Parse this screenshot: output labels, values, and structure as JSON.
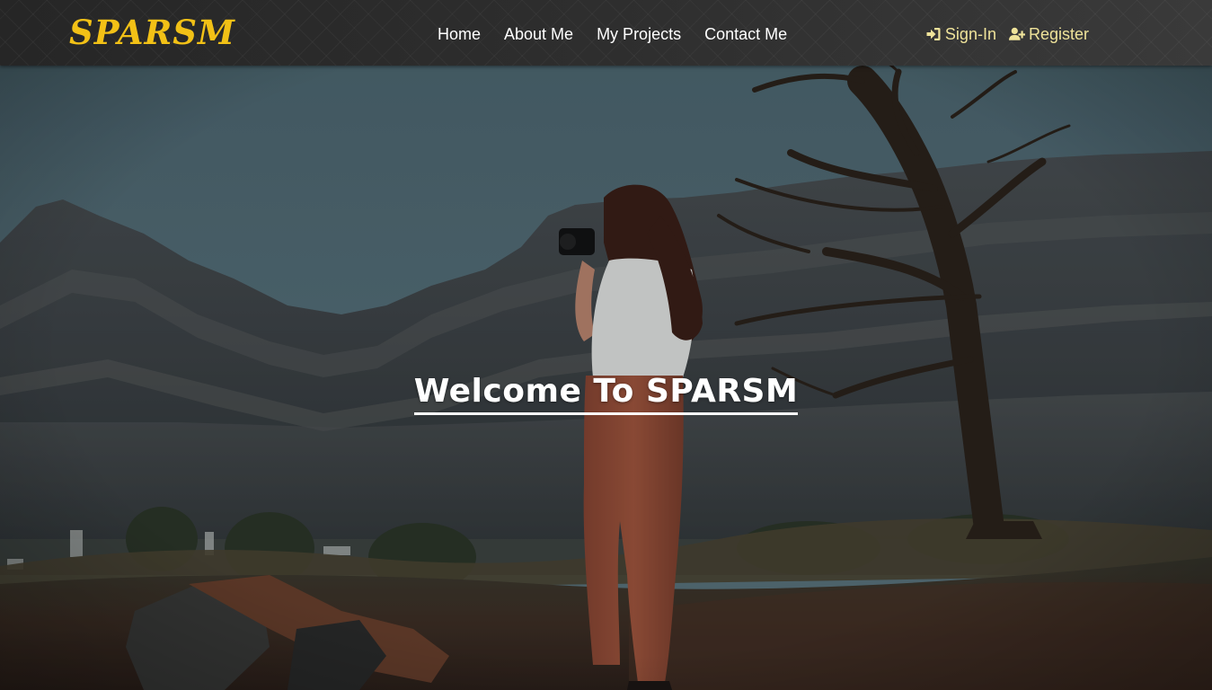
{
  "navbar": {
    "brand": "SPARSM",
    "links": [
      {
        "label": "Home"
      },
      {
        "label": "About Me"
      },
      {
        "label": "My Projects"
      },
      {
        "label": "Contact Me"
      }
    ],
    "auth": {
      "sign_in": {
        "label": "Sign-In",
        "icon": "sign-in-icon"
      },
      "register": {
        "label": "Register",
        "icon": "user-plus-icon"
      }
    }
  },
  "hero": {
    "title": "Welcome To SPARSM"
  },
  "colors": {
    "brand": "#f2c116",
    "auth_text": "#efe39a",
    "nav_text": "#ffffff",
    "navbar_bg": "#2a2a2a"
  }
}
